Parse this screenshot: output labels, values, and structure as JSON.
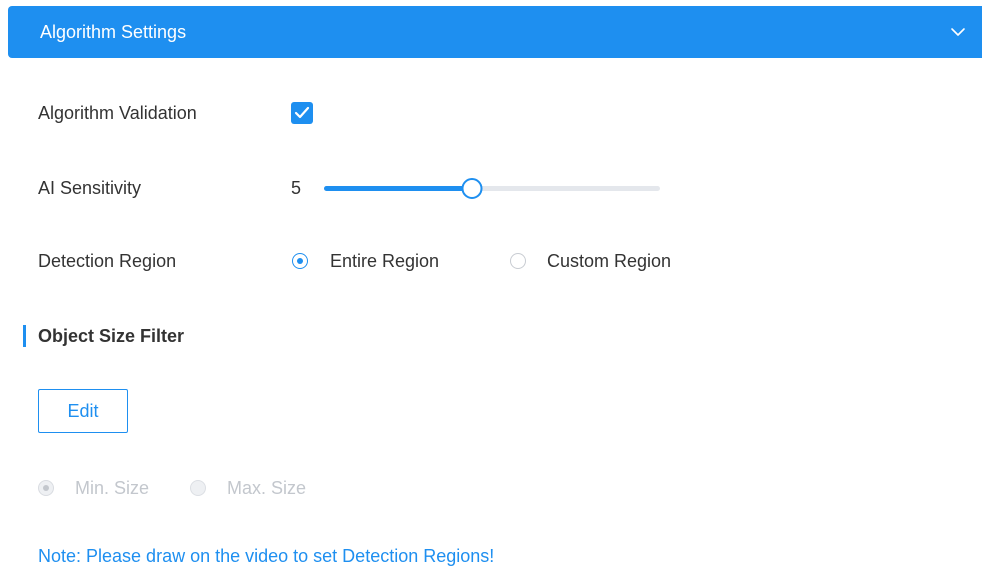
{
  "header": {
    "title": "Algorithm Settings",
    "chevron_icon": "chevron-down-icon",
    "background_color": "#1e8ff0"
  },
  "settings": {
    "algorithm_validation": {
      "label": "Algorithm Validation",
      "checked": true
    },
    "ai_sensitivity": {
      "label": "AI Sensitivity",
      "value": "5",
      "slider_fraction": 0.44
    },
    "detection_region": {
      "label": "Detection Region",
      "options": [
        {
          "label": "Entire Region",
          "selected": true
        },
        {
          "label": "Custom Region",
          "selected": false
        }
      ]
    }
  },
  "object_size_filter": {
    "title": "Object Size Filter",
    "edit_label": "Edit",
    "size_options": [
      {
        "label": "Min. Size",
        "selected": true,
        "disabled": true
      },
      {
        "label": "Max. Size",
        "selected": false,
        "disabled": true
      }
    ]
  },
  "note": "Note: Please draw on the video to set Detection Regions!",
  "colors": {
    "accent": "#1e8ff0",
    "text": "#333333",
    "disabled": "#c3c7cd"
  }
}
